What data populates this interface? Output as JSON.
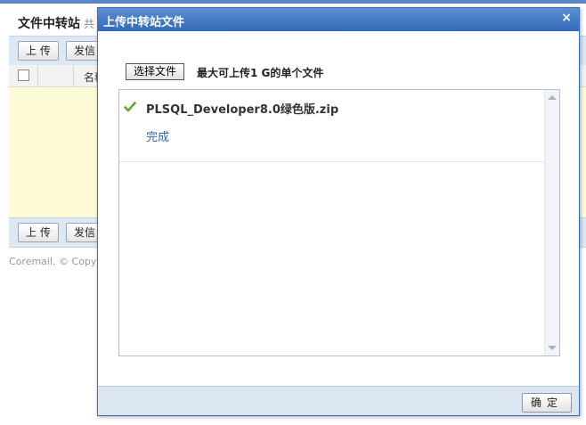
{
  "background_page": {
    "title": "文件中转站",
    "title_suffix": "共",
    "toolbar": {
      "upload_label": "上 传",
      "send_label": "发信"
    },
    "table": {
      "name_column": "名称"
    },
    "copyright": "Coremail. © Copyright"
  },
  "dialog": {
    "title": "上传中转站文件",
    "close_label": "×",
    "choose_file_label": "选择文件",
    "limit_text": "最大可上传1 G的单个文件",
    "files": [
      {
        "name": "PLSQL_Developer8.0绿色版.zip",
        "status": "完成",
        "icon": "check-icon"
      }
    ],
    "ok_label": "确定"
  },
  "colors": {
    "header_blue": "#336ab8",
    "status_blue": "#3565a3",
    "check_green": "#5fa82e",
    "list_bg": "#fefcd8"
  }
}
